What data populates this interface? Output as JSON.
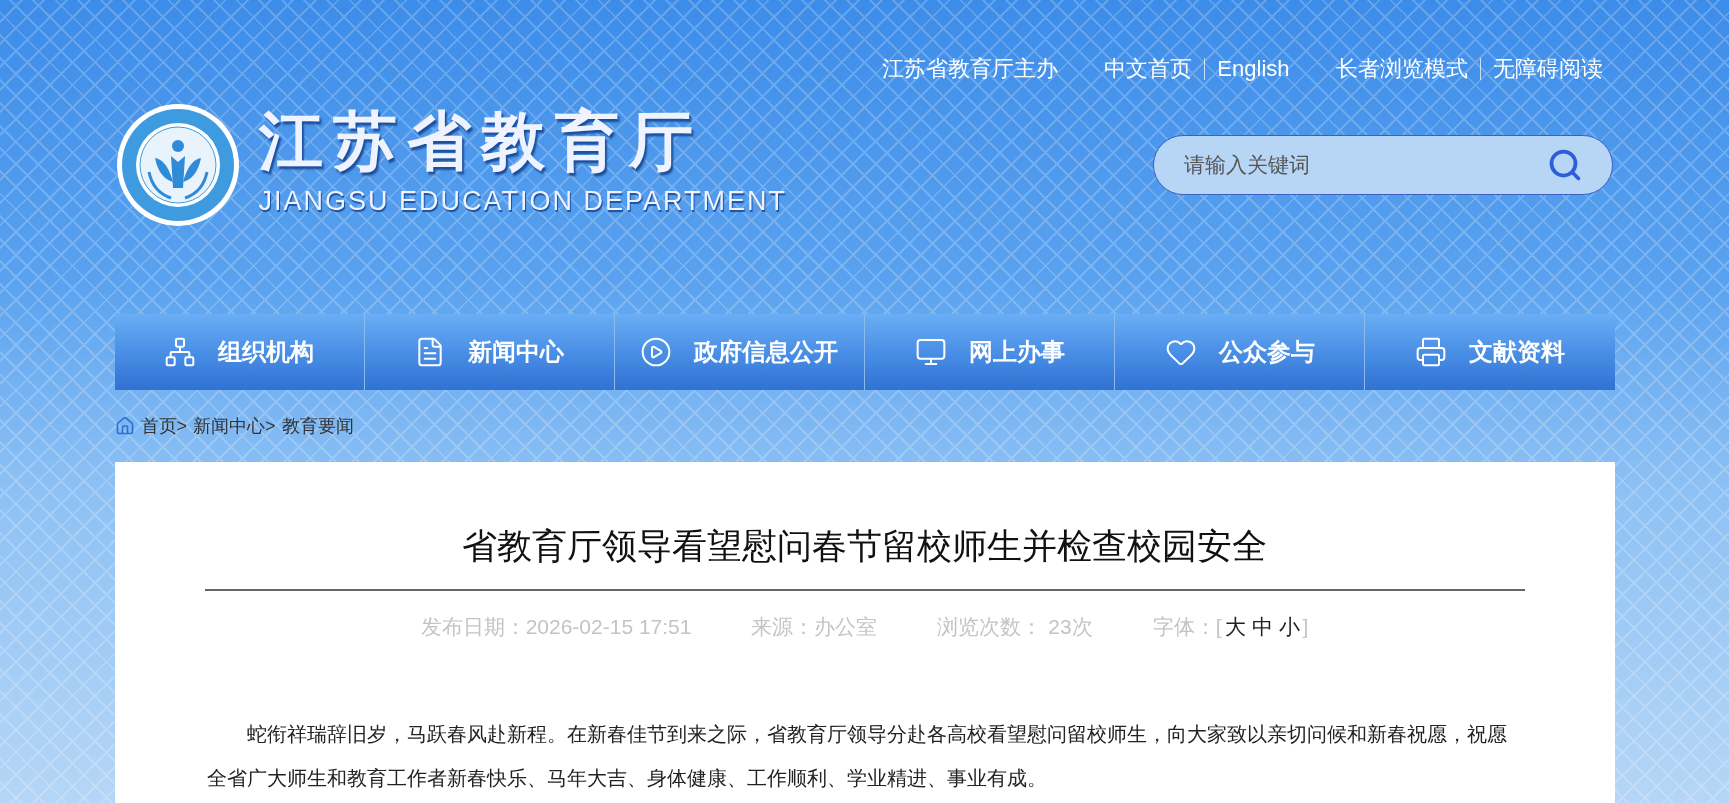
{
  "organizer": "江苏省教育厅主办",
  "link_groups": [
    [
      "中文首页",
      "English"
    ],
    [
      "长者浏览模式",
      "无障碍阅读"
    ]
  ],
  "site": {
    "title": "江苏省教育厅",
    "subtitle": "JIANGSU EDUCATION DEPARTMENT"
  },
  "search": {
    "placeholder": "请输入关键词"
  },
  "nav": [
    {
      "label": "组织机构"
    },
    {
      "label": "新闻中心"
    },
    {
      "label": "政府信息公开"
    },
    {
      "label": "网上办事"
    },
    {
      "label": "公众参与"
    },
    {
      "label": "文献资料"
    }
  ],
  "breadcrumb": [
    "首页>",
    "新闻中心>",
    "教育要闻"
  ],
  "article": {
    "title": "省教育厅领导看望慰问春节留校师生并检查校园安全",
    "meta": [
      "发布日期：2026-02-15 17:51",
      "来源：办公室",
      "浏览次数： 23次"
    ],
    "font_size": {
      "label": "字体：",
      "open": "[",
      "options": [
        "大",
        "中",
        "小"
      ],
      "close": "]"
    },
    "paragraphs": [
      "蛇衔祥瑞辞旧岁，马跃春风赴新程。在新春佳节到来之际，省教育厅领导分赴各高校看望慰问留校师生，向大家致以亲切问候和新春祝愿，祝愿全省广大师生和教育工作者新春快乐、马年大吉、身体健康、工作顺利、学业精进、事业有成。"
    ]
  }
}
